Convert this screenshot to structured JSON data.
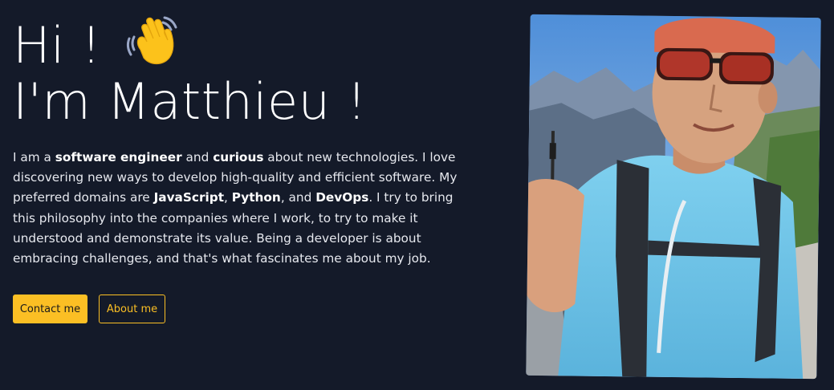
{
  "hero": {
    "greeting": "Hi !",
    "greeting_icon": "waving-hand-icon",
    "name_line": "I'm Matthieu !",
    "intro_parts": [
      {
        "text": "I am a ",
        "bold": false
      },
      {
        "text": "software engineer",
        "bold": true
      },
      {
        "text": " and ",
        "bold": false
      },
      {
        "text": "curious",
        "bold": true
      },
      {
        "text": " about new technologies. I love discovering new ways to develop high-quality and efficient software. My preferred domains are ",
        "bold": false
      },
      {
        "text": "JavaScript",
        "bold": true
      },
      {
        "text": ", ",
        "bold": false
      },
      {
        "text": "Python",
        "bold": true
      },
      {
        "text": ", and ",
        "bold": false
      },
      {
        "text": "DevOps",
        "bold": true
      },
      {
        "text": ". I try to bring this philosophy into the companies where I work, to try to make it understood and demonstrate its value. Being a developer is about embracing challenges, and that's what fascinates me about my job.",
        "bold": false
      }
    ],
    "buttons": {
      "contact": "Contact me",
      "about": "About me"
    },
    "photo_icon": "profile-photo"
  },
  "colors": {
    "background": "#141a29",
    "accent": "#fbbf24",
    "text": "#ffffff"
  }
}
